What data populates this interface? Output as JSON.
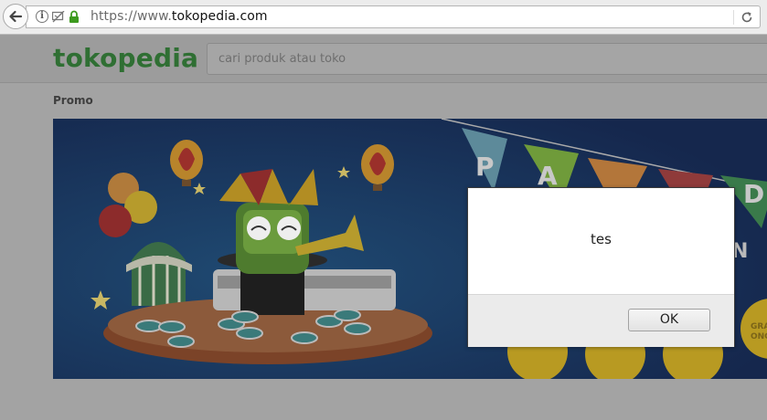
{
  "browser": {
    "url_scheme": "https://www.",
    "url_host": "tokopedia.com",
    "icons": [
      "back-arrow-icon",
      "info-icon",
      "tracking-protection-icon",
      "lock-icon",
      "reload-icon"
    ]
  },
  "header": {
    "logo": "tokopedia",
    "search_placeholder": "cari produk atau toko"
  },
  "promo": {
    "title": "Promo",
    "banner_letters": [
      "P",
      "A",
      "D",
      "N"
    ],
    "badge_partial": "GRA\nONG"
  },
  "dialog": {
    "message": "tes",
    "ok_label": "OK"
  },
  "colors": {
    "logo_green": "#2f6f33",
    "banner_bg": "#17305a"
  }
}
